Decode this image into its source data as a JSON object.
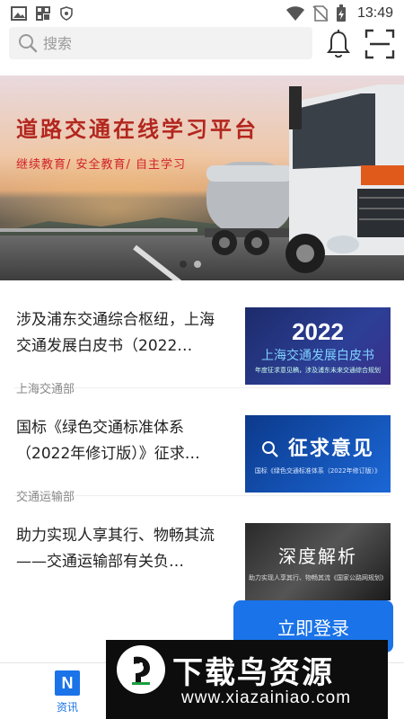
{
  "status_bar": {
    "time": "13:49",
    "icons": [
      "image-icon",
      "grid-app-icon",
      "shield-icon",
      "wifi-icon",
      "no-sim-icon",
      "battery-charging-icon"
    ]
  },
  "search": {
    "placeholder": "搜索"
  },
  "header_icons": [
    "bell-icon",
    "scan-icon"
  ],
  "banner": {
    "title": "道路交通在线学习平台",
    "subtitle": "继续教育/  安全教育/  自主学习",
    "pages": 2,
    "active_page": 1
  },
  "news": [
    {
      "title": "涉及浦东交通综合枢纽，上海交通发展白皮书（2022…",
      "source": "上海交通部",
      "thumb": {
        "year": "2022",
        "title": "上海交通发展白皮书",
        "caption": "年度征求意见稿，涉及浦东未来交通综合规划"
      }
    },
    {
      "title": "国标《绿色交通标准体系（2022年修订版）》征求…",
      "source": "交通运输部",
      "thumb": {
        "title": "征求意见",
        "caption": "国标《绿色交通标准体系（2022年修订版）》"
      }
    },
    {
      "title": "助力实现人享其行、物畅其流——交通运输部有关负…",
      "source": "",
      "thumb": {
        "title": "深度解析",
        "caption": "助力实现人享其行、物畅其流《国家公路网规划》"
      }
    }
  ],
  "login_button": "立即登录",
  "bottom_nav": [
    {
      "label": "资讯",
      "icon_letter": "N",
      "active": true
    }
  ],
  "watermark": {
    "title": "下载鸟资源",
    "url": "www.xiazainiao.com"
  },
  "colors": {
    "accent": "#1a73e8",
    "banner_title": "#b3261e"
  }
}
